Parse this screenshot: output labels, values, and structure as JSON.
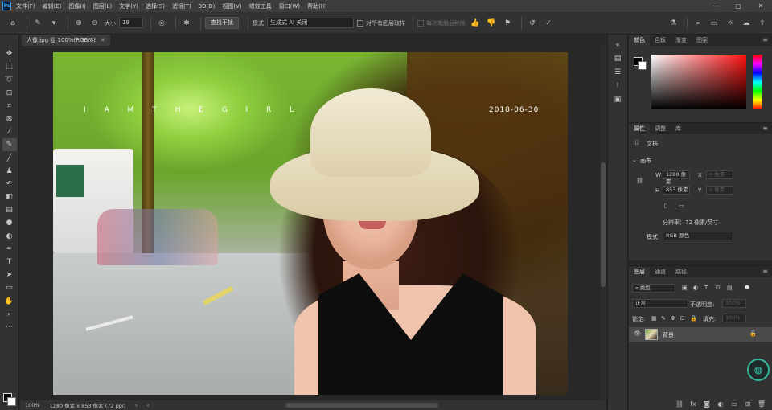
{
  "menubar": {
    "app_logo": "Ps",
    "items": [
      "文件(F)",
      "编辑(E)",
      "图像(I)",
      "图层(L)",
      "文字(Y)",
      "选择(S)",
      "滤镜(T)",
      "3D(D)",
      "视图(V)",
      "增效工具",
      "窗口(W)",
      "帮助(H)"
    ],
    "window_controls": [
      "—",
      "▢",
      "✕"
    ]
  },
  "options": {
    "size_label": "大小",
    "size_value": "19",
    "find_distractions": "查找干扰",
    "mode_label": "模式",
    "mode_value": "生成式 AI 关闭",
    "sample_all_layers": "对所有图层取样",
    "post_removal": "每次笔触后移除"
  },
  "document": {
    "tab_title": "人像.jpg @ 100%(RGB/8)",
    "overlay_text": "I A M T H E G I R L",
    "overlay_date": "2018-06-30"
  },
  "status": {
    "zoom": "100%",
    "dimensions": "1280 像素 x 853 像素 (72 ppi)"
  },
  "color_panel": {
    "tabs": [
      "颜色",
      "色板",
      "渐变",
      "图案"
    ]
  },
  "properties_panel": {
    "tabs": [
      "属性",
      "调整",
      "库"
    ],
    "doc_label": "文档",
    "canvas_section": "画布",
    "w_label": "W",
    "w_value": "1280 像素",
    "x_label": "X",
    "x_placeholder": "0 像素",
    "h_label": "H",
    "h_value": "853 像素",
    "y_label": "Y",
    "y_placeholder": "0 像素",
    "resolution": "分辨率：72 像素/英寸",
    "mode_label": "模式",
    "mode_value": "RGB 颜色"
  },
  "layers_panel": {
    "tabs": [
      "图层",
      "通道",
      "路径"
    ],
    "filter_label": "类型",
    "blend_mode": "正常",
    "opacity_label": "不透明度:",
    "opacity_value": "100%",
    "lock_label": "锁定:",
    "fill_label": "填充:",
    "fill_value": "100%",
    "layer_name": "背景"
  },
  "colors": {
    "accent": "#31a8ff",
    "assist": "#34b39a"
  }
}
